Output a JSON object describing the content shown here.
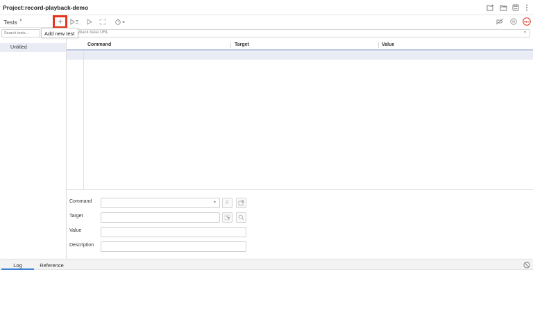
{
  "header": {
    "project_label": "Project:",
    "project_name": "record-playback-demo",
    "icons": [
      "new-project-icon",
      "open-project-icon",
      "save-project-icon",
      "more-options-icon"
    ]
  },
  "tests_panel": {
    "title": "Tests",
    "search_placeholder": "Search tests...",
    "items": [
      {
        "label": "Untitled",
        "selected": true
      }
    ]
  },
  "toolbar": {
    "icons": [
      "add-test-icon",
      "run-all-icon",
      "run-current-icon",
      "step-over-icon",
      "speed-icon"
    ],
    "right_icons": [
      "disable-breakpoints-icon",
      "pause-on-exception-icon",
      "record-icon"
    ],
    "record_label": "REC",
    "tooltip": "Add new test"
  },
  "base_url": {
    "placeholder": "Playback base URL",
    "visible_text": "yback base URL"
  },
  "table": {
    "columns": [
      "Command",
      "Target",
      "Value"
    ],
    "rows": []
  },
  "editor": {
    "command_label": "Command",
    "target_label": "Target",
    "value_label": "Value",
    "description_label": "Description"
  },
  "bottom": {
    "tabs": [
      {
        "label": "Log",
        "active": true
      },
      {
        "label": "Reference",
        "active": false
      }
    ]
  },
  "colors": {
    "highlight": "#e8321b",
    "record": "#d93a2b",
    "selection": "#e9ecf4",
    "active_tab": "#3b82d6"
  }
}
